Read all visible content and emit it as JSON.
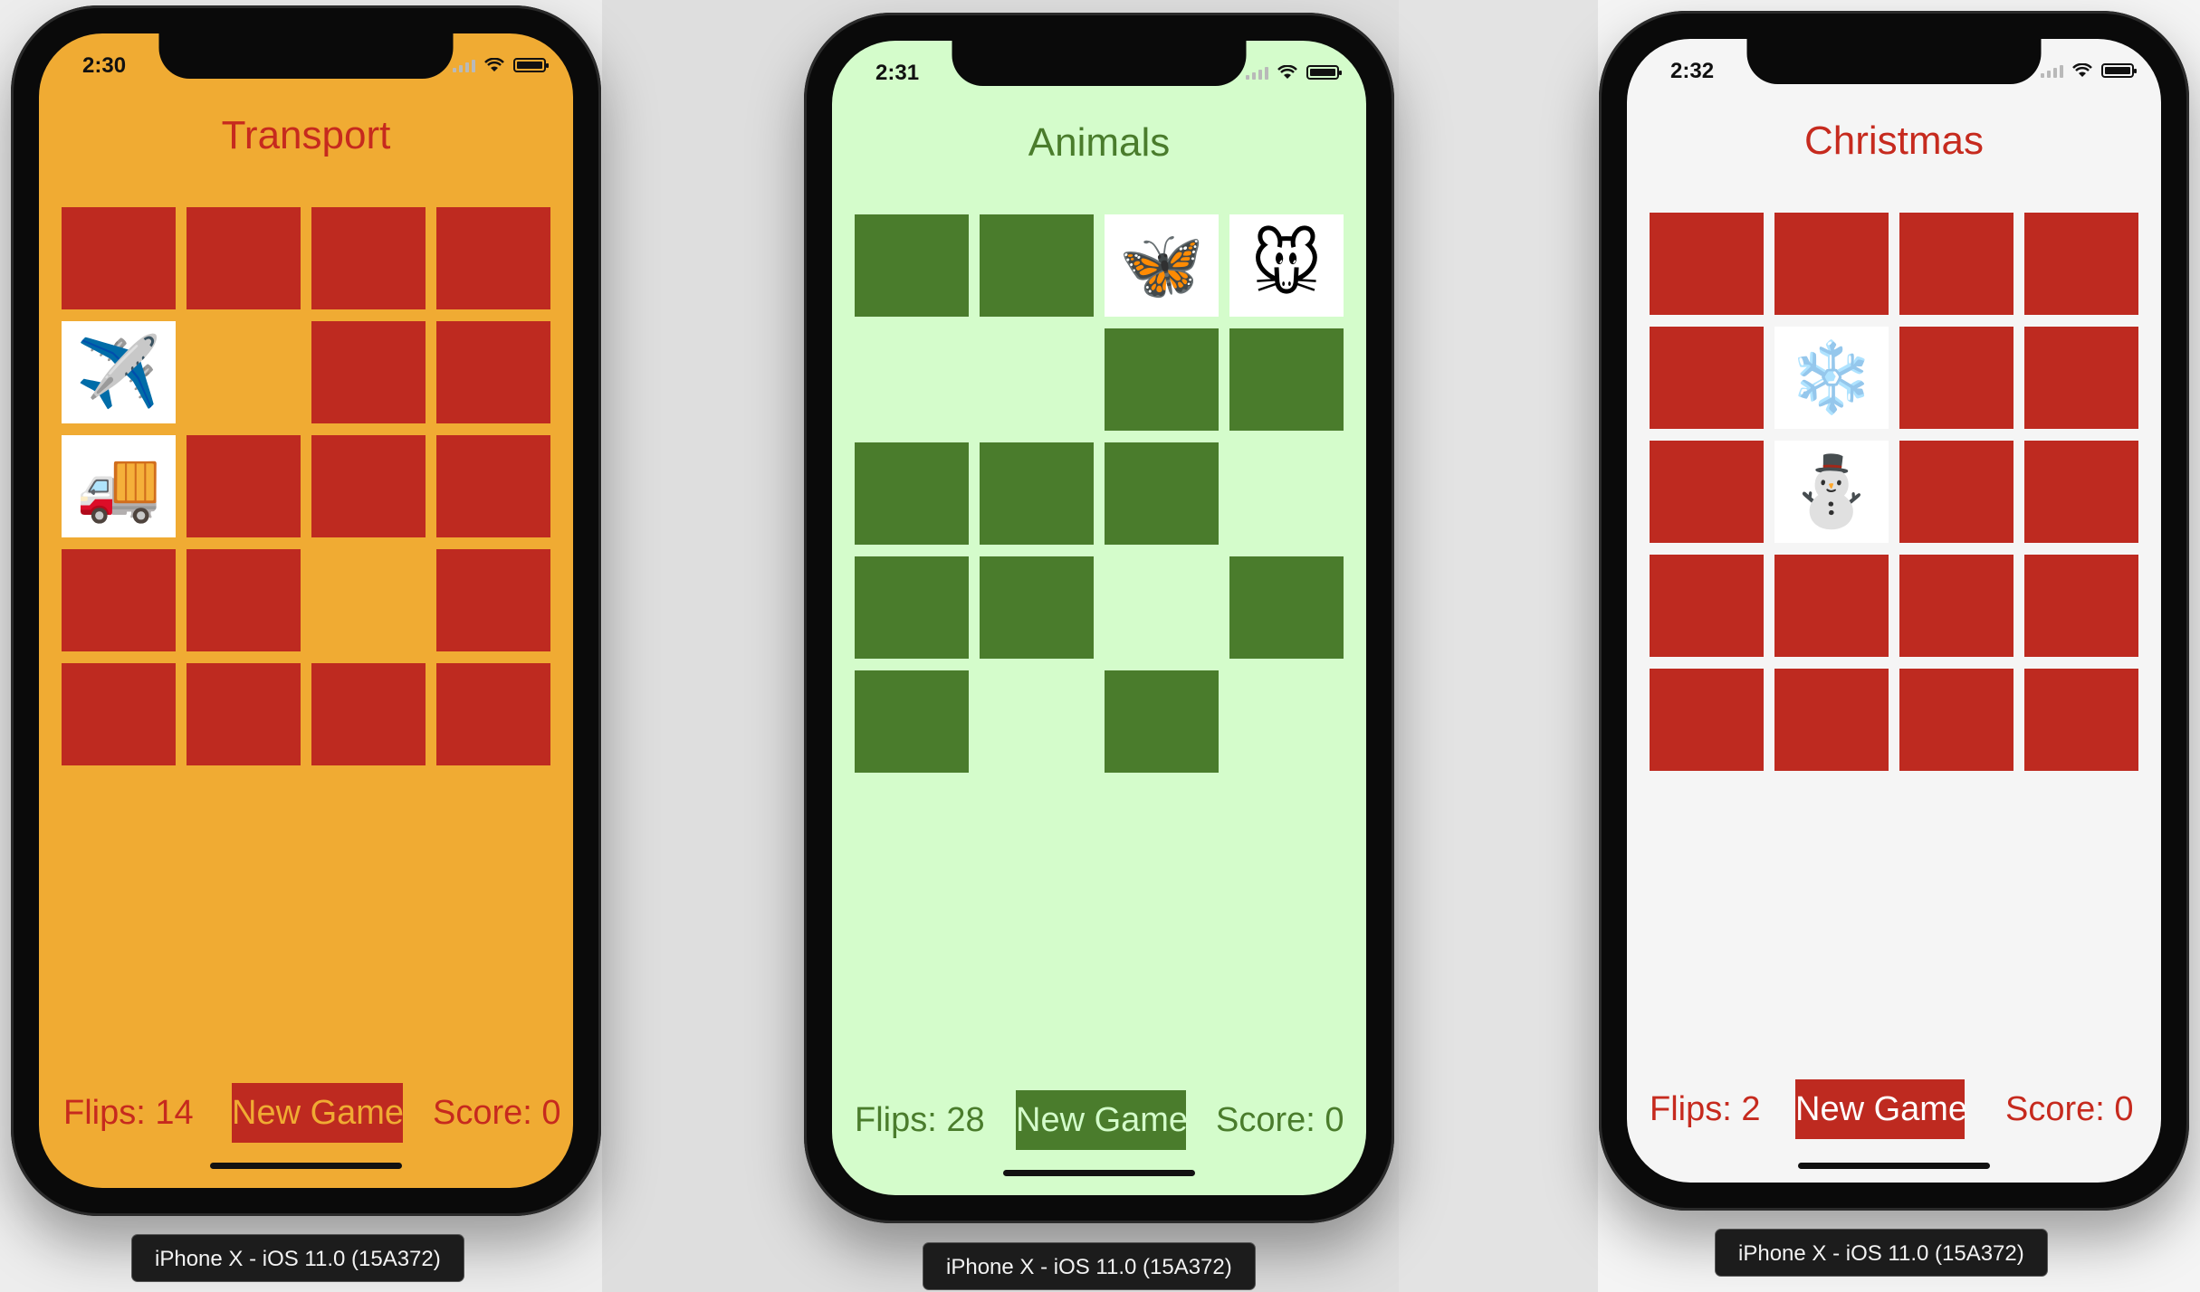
{
  "simulators": [
    {
      "time": "2:30",
      "theme_title": "Transport",
      "colors": {
        "background": "#f0ab33",
        "card_back": "#be2a20",
        "text": "#c62a1e",
        "button_bg": "#be2a20",
        "button_text": "#f0ab33"
      },
      "cards": [
        "down",
        "down",
        "down",
        "down",
        "✈️",
        "matched",
        "down",
        "down",
        "🚚",
        "down",
        "down",
        "down",
        "down",
        "down",
        "matched",
        "down",
        "down",
        "down",
        "down",
        "down"
      ],
      "flips_label": "Flips: 14",
      "new_game_label": "New Game",
      "score_label": "Score: 0",
      "device_label": "iPhone X - iOS 11.0 (15A372)"
    },
    {
      "time": "2:31",
      "theme_title": "Animals",
      "colors": {
        "background": "#d4fccb",
        "card_back": "#4a7c2c",
        "text": "#4a7c2c",
        "button_bg": "#4a7c2c",
        "button_text": "#d4fccb"
      },
      "cards": [
        "down",
        "down",
        "🦋",
        "🐭",
        "matched",
        "matched",
        "down",
        "down",
        "down",
        "down",
        "down",
        "matched",
        "down",
        "down",
        "matched",
        "down",
        "down",
        "matched",
        "down",
        "matched"
      ],
      "flips_label": "Flips: 28",
      "new_game_label": "New Game",
      "score_label": "Score: 0",
      "device_label": "iPhone X - iOS 11.0 (15A372)"
    },
    {
      "time": "2:32",
      "theme_title": "Christmas",
      "colors": {
        "background": "#f5f5f5",
        "card_back": "#be2a20",
        "text": "#c62a1e",
        "button_bg": "#be2a20",
        "button_text": "#ffffff"
      },
      "cards": [
        "down",
        "down",
        "down",
        "down",
        "down",
        "❄️",
        "down",
        "down",
        "down",
        "⛄",
        "down",
        "down",
        "down",
        "down",
        "down",
        "down",
        "down",
        "down",
        "down",
        "down"
      ],
      "flips_label": "Flips: 2",
      "new_game_label": "New Game",
      "score_label": "Score: 0",
      "device_label": "iPhone X - iOS 11.0 (15A372)"
    }
  ]
}
